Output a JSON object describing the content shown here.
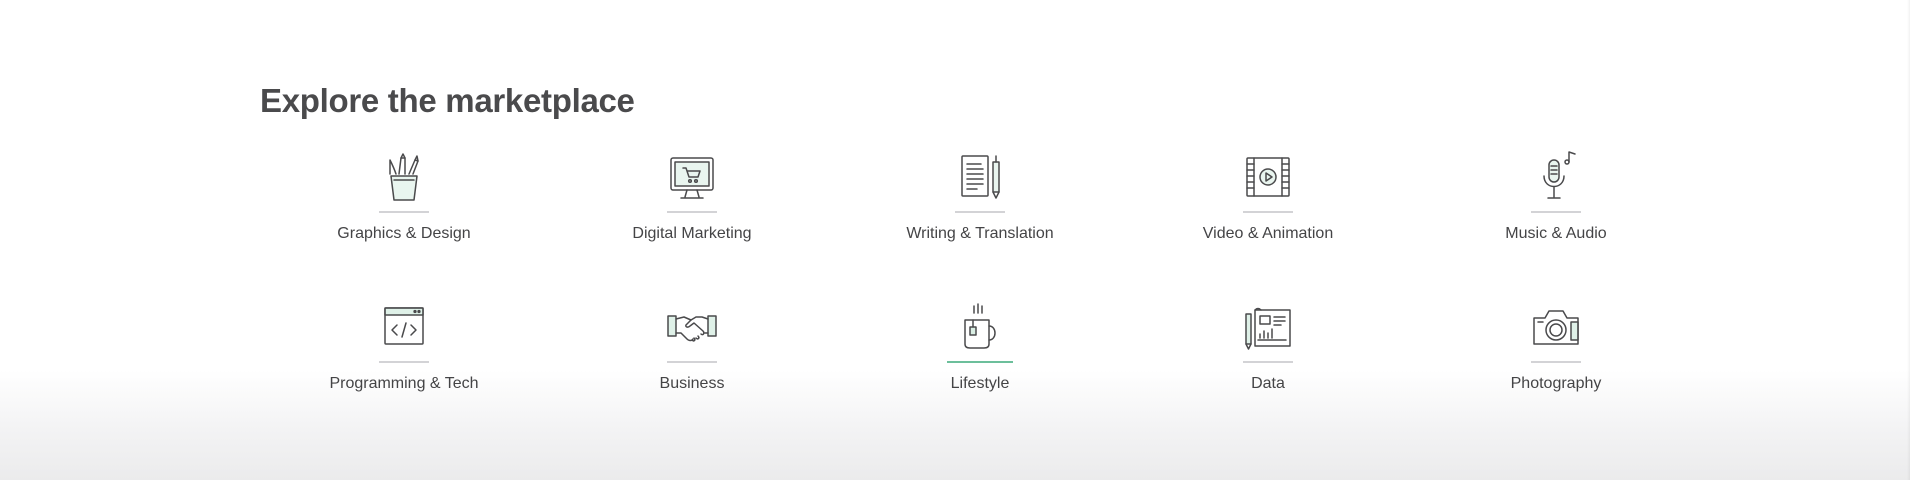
{
  "section": {
    "title": "Explore the marketplace"
  },
  "categories": [
    {
      "label": "Graphics & Design",
      "icon": "pencil-cup-icon"
    },
    {
      "label": "Digital Marketing",
      "icon": "monitor-cart-icon"
    },
    {
      "label": "Writing & Translation",
      "icon": "document-pen-icon"
    },
    {
      "label": "Video & Animation",
      "icon": "film-play-icon"
    },
    {
      "label": "Music & Audio",
      "icon": "microphone-note-icon"
    },
    {
      "label": "Programming & Tech",
      "icon": "code-window-icon"
    },
    {
      "label": "Business",
      "icon": "handshake-icon"
    },
    {
      "label": "Lifestyle",
      "icon": "mug-icon",
      "active": true
    },
    {
      "label": "Data",
      "icon": "data-board-icon"
    },
    {
      "label": "Photography",
      "icon": "camera-icon"
    }
  ],
  "colors": {
    "icon_stroke": "#4a4a4c",
    "icon_accent": "#bfe3d1",
    "divider": "#d3d3d6",
    "divider_active": "#6cbf9b",
    "title": "#4a4a4c"
  }
}
